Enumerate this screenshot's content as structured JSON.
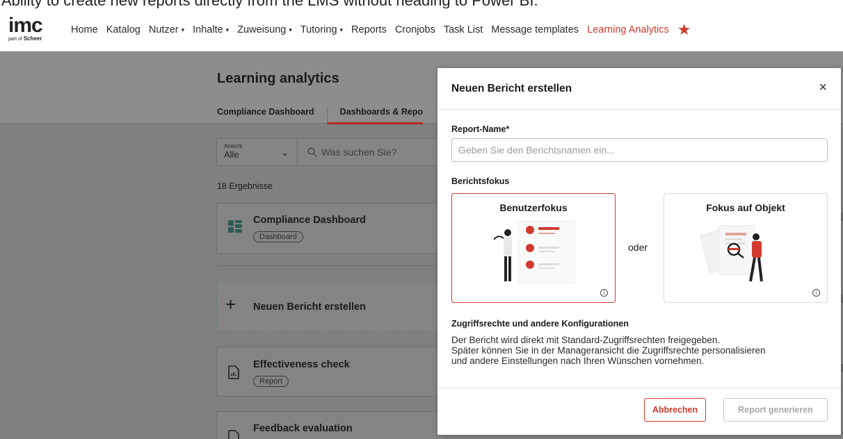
{
  "caption": "Ability to create new reports directly from the LMS without heading to Power BI.",
  "logo": {
    "brand": "imc",
    "sub_prefix": "part of",
    "sub_brand": "Scheer"
  },
  "nav": {
    "items": [
      {
        "label": "Home"
      },
      {
        "label": "Katalog"
      },
      {
        "label": "Nutzer",
        "dropdown": true
      },
      {
        "label": "Inhalte",
        "dropdown": true
      },
      {
        "label": "Zuweisung",
        "dropdown": true
      },
      {
        "label": "Tutoring",
        "dropdown": true
      },
      {
        "label": "Reports"
      },
      {
        "label": "Cronjobs"
      },
      {
        "label": "Task List"
      },
      {
        "label": "Message templates"
      },
      {
        "label": "Learning Analytics",
        "active": true
      }
    ],
    "caret": "▾",
    "star_icon": "star-icon"
  },
  "page": {
    "title": "Learning analytics",
    "tabs": [
      "Compliance Dashboard",
      "Dashboards & Repo"
    ],
    "filter": {
      "view_label": "Ansicht",
      "view_value": "Alle",
      "search_placeholder": "Was suchen Sie?"
    },
    "results": "18 Ergebnisse",
    "cards": [
      {
        "title": "Compliance Dashboard",
        "badge": "Dashboard"
      },
      {
        "title": "Neuen Bericht erstellen"
      },
      {
        "title": "Effectiveness check",
        "badge": "Report"
      },
      {
        "title": "Feedback evaluation"
      }
    ]
  },
  "modal": {
    "title": "Neuen Bericht erstellen",
    "close": "×",
    "name_label": "Report-Name*",
    "name_placeholder": "Geben Sie den Berichtsnamen ein...",
    "focus_label": "Berichtsfokus",
    "focus_user": "Benutzerfokus",
    "focus_object": "Fokus auf Objekt",
    "or": "oder",
    "access_label": "Zugriffsrechte und andere Konfigurationen",
    "access_lines": [
      "Der Bericht wird direkt mit Standard-Zugriffsrechten freigegeben.",
      "Später können Sie in der Manageransicht die Zugriffsrechte personalisieren",
      "und andere Einstellungen nach Ihren Wünschen vornehmen."
    ],
    "cancel": "Abbrechen",
    "generate": "Report generieren",
    "info": "i"
  },
  "colors": {
    "accent": "#d13a2e",
    "overlay": "#808080",
    "modal_bg": "#ffffff",
    "disabled": "#a8a8a8"
  }
}
